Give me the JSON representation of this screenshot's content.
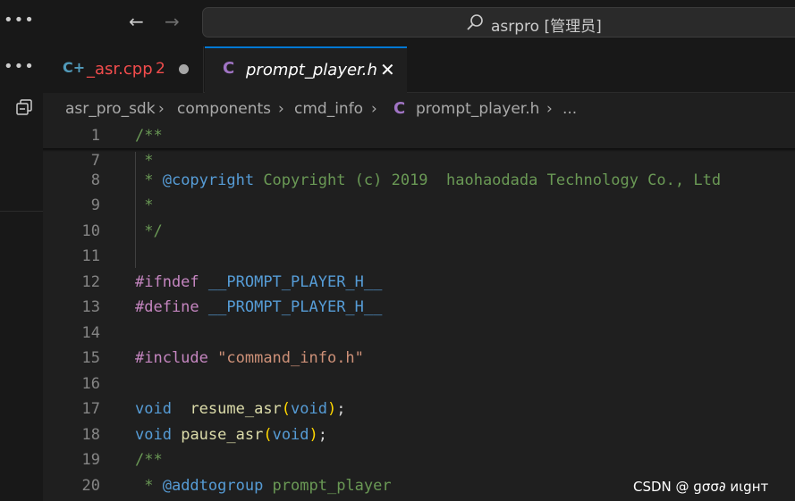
{
  "titlebar": {
    "menu_dots": "•••",
    "back_glyph": "←",
    "forward_glyph": "→",
    "command_center_text": "asrpro [管理员]",
    "search_icon": "search-icon"
  },
  "sidebar": {
    "menu_dots": "•••",
    "collapse_icon": "collapse-all-icon"
  },
  "tabs": [
    {
      "icon": "C+",
      "label": "_asr.cpp",
      "problems": "2",
      "dirty": true,
      "color": "#f14c4c"
    },
    {
      "icon": "C",
      "label": "prompt_player.h",
      "close": "✕",
      "active": true
    }
  ],
  "breadcrumb": {
    "items": [
      "asr_pro_sdk",
      "components",
      "cmd_info",
      "prompt_player.h",
      "..."
    ],
    "separator": "›",
    "file_icon": "C"
  },
  "editor": {
    "lines": [
      {
        "n": "1",
        "t": [
          {
            "c": "tk-comment",
            "v": "/**"
          }
        ]
      },
      {
        "n": "7",
        "t": [
          {
            "c": "tk-comment",
            "v": " *"
          }
        ]
      },
      {
        "n": "8",
        "t": [
          {
            "c": "tk-comment",
            "v": " * "
          },
          {
            "c": "tk-doc",
            "v": "@copyright"
          },
          {
            "c": "tk-doctext",
            "v": " Copyright (c) 2019  haohaodada Technology Co., Ltd"
          }
        ]
      },
      {
        "n": "9",
        "t": [
          {
            "c": "tk-comment",
            "v": " *"
          }
        ]
      },
      {
        "n": "10",
        "t": [
          {
            "c": "tk-comment",
            "v": " */"
          }
        ]
      },
      {
        "n": "11",
        "t": []
      },
      {
        "n": "12",
        "t": [
          {
            "c": "tk-pre",
            "v": "#ifndef"
          },
          {
            "c": "tk-plain",
            "v": " "
          },
          {
            "c": "tk-macro",
            "v": "__PROMPT_PLAYER_H__"
          }
        ]
      },
      {
        "n": "13",
        "t": [
          {
            "c": "tk-pre",
            "v": "#define"
          },
          {
            "c": "tk-plain",
            "v": " "
          },
          {
            "c": "tk-macro",
            "v": "__PROMPT_PLAYER_H__"
          }
        ]
      },
      {
        "n": "14",
        "t": []
      },
      {
        "n": "15",
        "t": [
          {
            "c": "tk-pre",
            "v": "#include"
          },
          {
            "c": "tk-plain",
            "v": " "
          },
          {
            "c": "tk-str",
            "v": "\"command_info.h\""
          }
        ]
      },
      {
        "n": "16",
        "t": []
      },
      {
        "n": "17",
        "t": [
          {
            "c": "tk-kw",
            "v": "void"
          },
          {
            "c": "tk-plain",
            "v": "  "
          },
          {
            "c": "tk-fn",
            "v": "resume_asr"
          },
          {
            "c": "tk-paren",
            "v": "("
          },
          {
            "c": "tk-kw",
            "v": "void"
          },
          {
            "c": "tk-paren",
            "v": ")"
          },
          {
            "c": "tk-plain",
            "v": ";"
          }
        ]
      },
      {
        "n": "18",
        "t": [
          {
            "c": "tk-kw",
            "v": "void"
          },
          {
            "c": "tk-plain",
            "v": " "
          },
          {
            "c": "tk-fn",
            "v": "pause_asr"
          },
          {
            "c": "tk-paren",
            "v": "("
          },
          {
            "c": "tk-kw",
            "v": "void"
          },
          {
            "c": "tk-paren",
            "v": ")"
          },
          {
            "c": "tk-plain",
            "v": ";"
          }
        ]
      },
      {
        "n": "19",
        "t": [
          {
            "c": "tk-comment",
            "v": "/**"
          }
        ]
      },
      {
        "n": "20",
        "t": [
          {
            "c": "tk-comment",
            "v": " * "
          },
          {
            "c": "tk-doc",
            "v": "@addtogroup"
          },
          {
            "c": "tk-doctext",
            "v": " prompt_player"
          }
        ]
      }
    ]
  },
  "watermark": "CSDN @   ɡσσ∂ иιgнт"
}
